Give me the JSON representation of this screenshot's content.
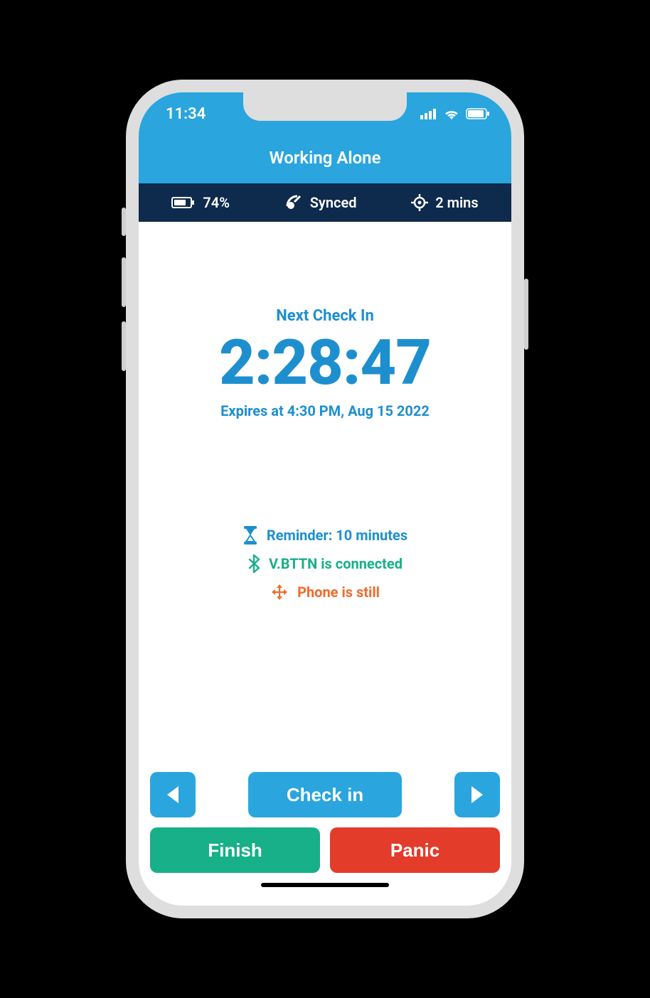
{
  "statusbar": {
    "time": "11:34"
  },
  "header": {
    "title": "Working Alone"
  },
  "infobar": {
    "battery": "74%",
    "sync": "Synced",
    "locationInterval": "2 mins"
  },
  "checkin": {
    "label": "Next Check In",
    "countdown": "2:28:47",
    "expires": "Expires at 4:30 PM, Aug 15 2022"
  },
  "statuses": {
    "reminder": "Reminder: 10 minutes",
    "bluetooth": "V.BTTN is connected",
    "motion": "Phone is still"
  },
  "buttons": {
    "checkin": "Check in",
    "finish": "Finish",
    "panic": "Panic"
  },
  "colors": {
    "primary": "#2aa5de",
    "dark": "#0e2a4d",
    "green": "#17b089",
    "red": "#e33c2b",
    "orange": "#f26a2a"
  }
}
